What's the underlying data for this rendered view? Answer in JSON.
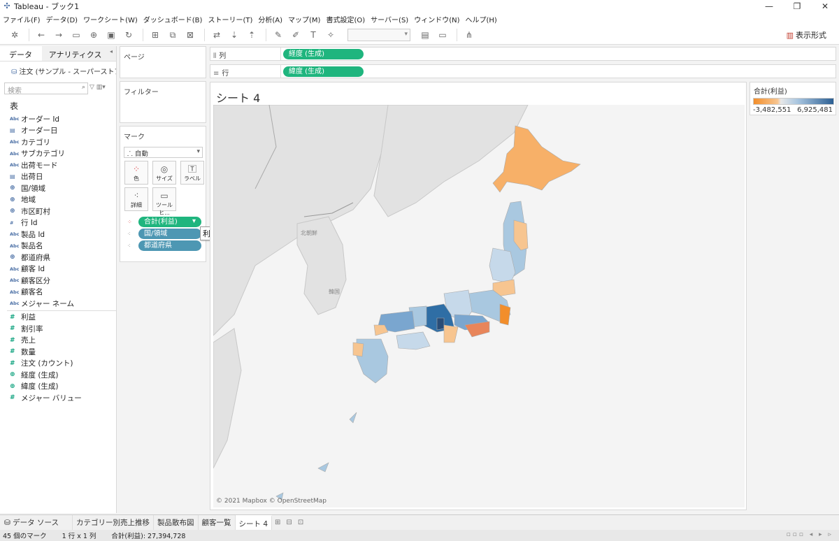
{
  "window": {
    "title": "Tableau - ブック1",
    "controls": [
      "—",
      "❐",
      "✕"
    ]
  },
  "menu": [
    "ファイル(F)",
    "データ(D)",
    "ワークシート(W)",
    "ダッシュボード(B)",
    "ストーリー(T)",
    "分析(A)",
    "マップ(M)",
    "書式設定(O)",
    "サーバー(S)",
    "ウィンドウ(N)",
    "ヘルプ(H)"
  ],
  "toolbar": {
    "show_me": "表示形式"
  },
  "left_pane": {
    "tab_data": "データ",
    "tab_analytics": "アナリティクス",
    "datasource": "注文 (サンプル - スーパーストア...",
    "search_placeholder": "検索",
    "section_tables": "表",
    "dimensions": [
      {
        "type": "Abc",
        "name": "オーダー Id"
      },
      {
        "type": "date",
        "name": "オーダー日"
      },
      {
        "type": "Abc",
        "name": "カテゴリ"
      },
      {
        "type": "Abc",
        "name": "サブカテゴリ"
      },
      {
        "type": "Abc",
        "name": "出荷モード"
      },
      {
        "type": "date",
        "name": "出荷日"
      },
      {
        "type": "geo",
        "name": "国/領域"
      },
      {
        "type": "geo",
        "name": "地域"
      },
      {
        "type": "geo",
        "name": "市区町村"
      },
      {
        "type": "#",
        "name": "行 Id"
      },
      {
        "type": "Abc",
        "name": "製品 Id"
      },
      {
        "type": "Abc",
        "name": "製品名"
      },
      {
        "type": "geo",
        "name": "都道府県"
      },
      {
        "type": "Abc",
        "name": "顧客 Id"
      },
      {
        "type": "Abc",
        "name": "顧客区分"
      },
      {
        "type": "Abc",
        "name": "顧客名"
      },
      {
        "type": "Abc",
        "name": "メジャー ネーム"
      }
    ],
    "measures": [
      {
        "type": "#",
        "name": "利益"
      },
      {
        "type": "#",
        "name": "割引率"
      },
      {
        "type": "#",
        "name": "売上"
      },
      {
        "type": "#",
        "name": "数量"
      },
      {
        "type": "#",
        "name": "注文 (カウント)"
      },
      {
        "type": "geo",
        "name": "経度 (生成)"
      },
      {
        "type": "geo",
        "name": "緯度 (生成)"
      },
      {
        "type": "#",
        "name": "メジャー バリュー"
      }
    ]
  },
  "cards": {
    "pages": "ページ",
    "filters": "フィルター",
    "marks": "マーク",
    "mark_type": "自動",
    "mark_buttons": [
      {
        "icon": "color-icon",
        "label": "色"
      },
      {
        "icon": "size-icon",
        "label": "サイズ"
      },
      {
        "icon": "label-icon",
        "label": "ラベル"
      },
      {
        "icon": "detail-icon",
        "label": "詳細"
      },
      {
        "icon": "tooltip-icon",
        "label": "ツールヒ..."
      }
    ],
    "mark_pills": [
      {
        "label": "合計(利益)",
        "color": "green"
      },
      {
        "label": "国/領域",
        "color": "blue"
      },
      {
        "label": "都道府県",
        "color": "blue"
      }
    ],
    "hover_tooltip": "利益"
  },
  "shelves": {
    "columns_label": "列",
    "columns_pill": "経度 (生成)",
    "rows_label": "行",
    "rows_pill": "緯度 (生成)"
  },
  "sheet": {
    "title": "シート 4",
    "attribution": "© 2021 Mapbox © OpenStreetMap",
    "map_labels": [
      {
        "text": "北朝鮮"
      },
      {
        "text": "韓国"
      }
    ]
  },
  "legend": {
    "title": "合計(利益)",
    "min": "-3,482,551",
    "max": "6,925,481",
    "color_low": "#f28e2b",
    "color_high": "#2c5f93"
  },
  "sheet_tabs": {
    "datasource": "データ ソース",
    "tabs": [
      "カテゴリー別売上推移",
      "製品散布図",
      "顧客一覧",
      "シート 4"
    ],
    "active": "シート 4"
  },
  "status": {
    "marks": "45 個のマーク",
    "grid": "1 行 x 1 列",
    "sum": "合計(利益): 27,394,728"
  }
}
